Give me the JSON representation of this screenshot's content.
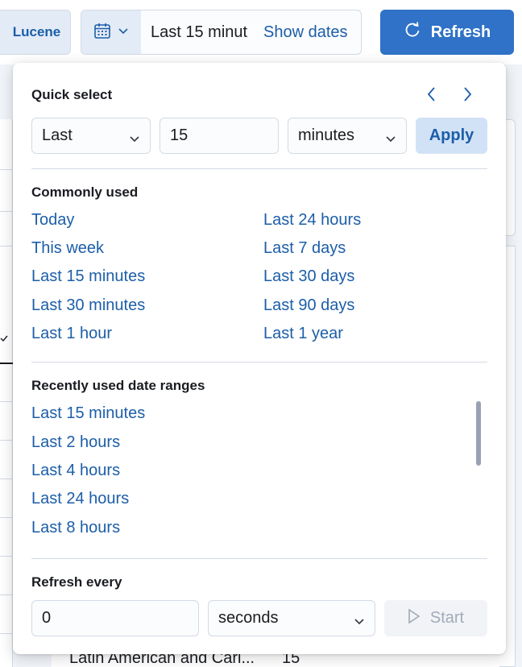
{
  "topbar": {
    "query_language_label": "Lucene",
    "date_range_text": "Last 15 minut",
    "show_dates_label": "Show dates",
    "refresh_label": "Refresh"
  },
  "background": {
    "row_name": "Latin American and Cari...",
    "row_count": "15"
  },
  "quick_select": {
    "title": "Quick select",
    "direction_value": "Last",
    "amount_value": "15",
    "unit_value": "minutes",
    "apply_label": "Apply"
  },
  "commonly_used": {
    "title": "Commonly used",
    "left_items": [
      "Today",
      "This week",
      "Last 15 minutes",
      "Last 30 minutes",
      "Last 1 hour"
    ],
    "right_items": [
      "Last 24 hours",
      "Last 7 days",
      "Last 30 days",
      "Last 90 days",
      "Last 1 year"
    ]
  },
  "recently_used": {
    "title": "Recently used date ranges",
    "items": [
      "Last 15 minutes",
      "Last 2 hours",
      "Last 4 hours",
      "Last 24 hours",
      "Last 8 hours"
    ]
  },
  "refresh_every": {
    "title": "Refresh every",
    "interval_value": "0",
    "unit_value": "seconds",
    "start_label": "Start"
  },
  "colors": {
    "primary": "#2f72c7",
    "link": "#1c5ea8",
    "apply_bg": "#d2e2f6",
    "disabled_text": "#a2abba"
  },
  "icons": [
    "calendar-icon",
    "chevron-down-icon",
    "refresh-icon",
    "chevron-left-icon",
    "chevron-right-icon",
    "play-icon"
  ]
}
